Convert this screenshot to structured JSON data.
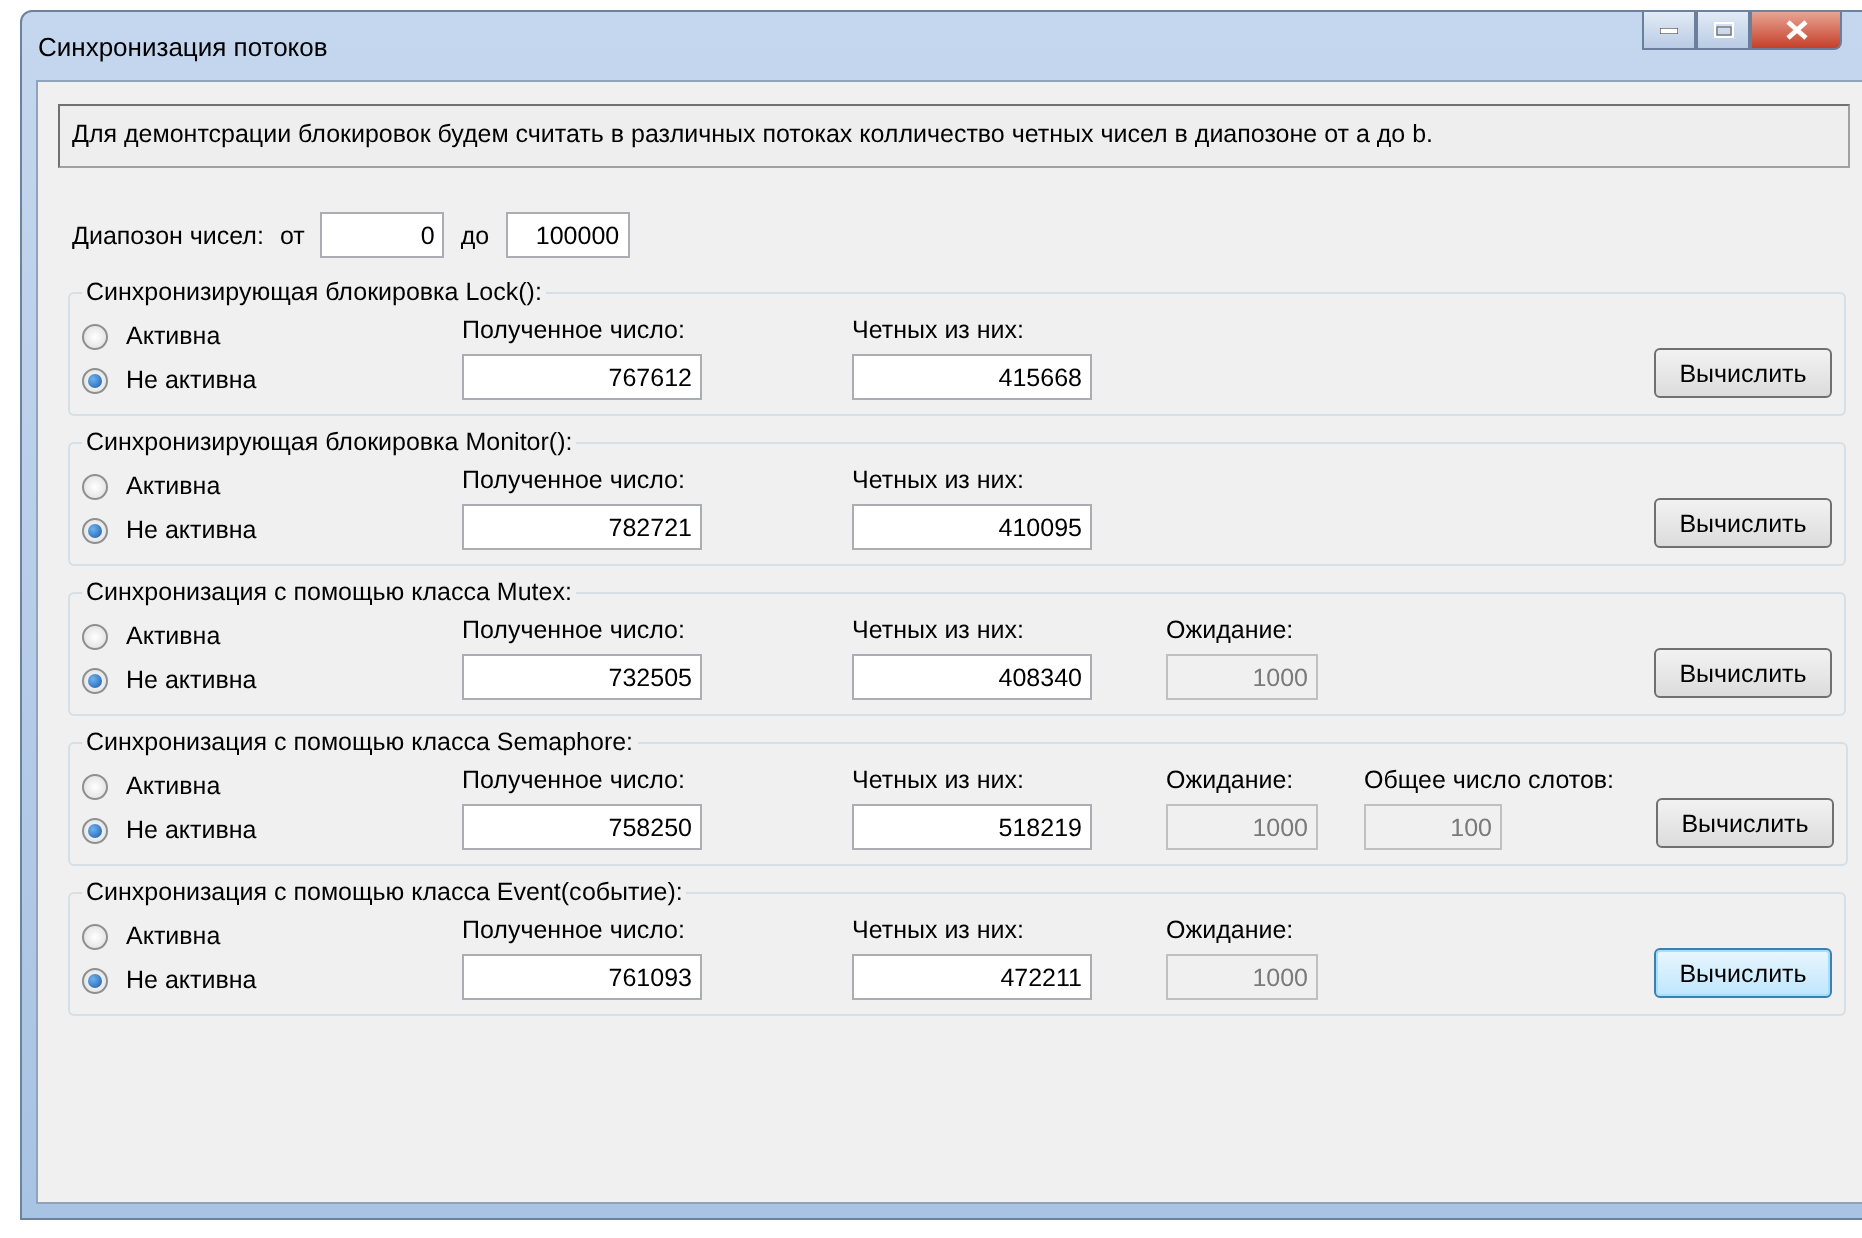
{
  "window": {
    "title": "Синхронизация потоков"
  },
  "description": "Для демонтсрации блокировок будем считать в различных потоках колличество четных чисел в диапозоне от a до b.",
  "range": {
    "label": "Диапозон чисел:",
    "from_label": "от",
    "from_value": "0",
    "to_label": "до",
    "to_value": "100000"
  },
  "groups": [
    {
      "title": "Синхронизирующая блокировка Lock():",
      "radios": [
        {
          "label": "Активна",
          "selected": false
        },
        {
          "label": "Не активна",
          "selected": true
        }
      ],
      "fields": [
        {
          "label": "Полученное число:",
          "value": "767612",
          "disabled": false
        },
        {
          "label": "Четных из них:",
          "value": "415668",
          "disabled": false
        }
      ],
      "button": {
        "label": "Вычислить",
        "focused": false
      }
    },
    {
      "title": "Синхронизирующая блокировка Monitor():",
      "radios": [
        {
          "label": "Активна",
          "selected": false
        },
        {
          "label": "Не активна",
          "selected": true
        }
      ],
      "fields": [
        {
          "label": "Полученное число:",
          "value": "782721",
          "disabled": false
        },
        {
          "label": "Четных из них:",
          "value": "410095",
          "disabled": false
        }
      ],
      "button": {
        "label": "Вычислить",
        "focused": false
      }
    },
    {
      "title": "Синхронизация с помощью класса Mutex:",
      "radios": [
        {
          "label": "Активна",
          "selected": false
        },
        {
          "label": "Не активна",
          "selected": true
        }
      ],
      "fields": [
        {
          "label": "Полученное число:",
          "value": "732505",
          "disabled": false
        },
        {
          "label": "Четных из них:",
          "value": "408340",
          "disabled": false
        },
        {
          "label": "Ожидание:",
          "value": "1000",
          "disabled": true
        }
      ],
      "button": {
        "label": "Вычислить",
        "focused": false
      }
    },
    {
      "title": "Синхронизация с помощью класса Semaphore:",
      "radios": [
        {
          "label": "Активна",
          "selected": false
        },
        {
          "label": "Не активна",
          "selected": true
        }
      ],
      "fields": [
        {
          "label": "Полученное число:",
          "value": "758250",
          "disabled": false
        },
        {
          "label": "Четных из них:",
          "value": "518219",
          "disabled": false
        },
        {
          "label": "Ожидание:",
          "value": "1000",
          "disabled": true
        },
        {
          "label": "Общее число слотов:",
          "value": "100",
          "disabled": true
        }
      ],
      "button": {
        "label": "Вычислить",
        "focused": false
      }
    },
    {
      "title": "Синхронизация с помощью класса Event(событие):",
      "radios": [
        {
          "label": "Активна",
          "selected": false
        },
        {
          "label": "Не активна",
          "selected": true
        }
      ],
      "fields": [
        {
          "label": "Полученное число:",
          "value": "761093",
          "disabled": false
        },
        {
          "label": "Четных из них:",
          "value": "472211",
          "disabled": false
        },
        {
          "label": "Ожидание:",
          "value": "1000",
          "disabled": true
        }
      ],
      "button": {
        "label": "Вычислить",
        "focused": true
      }
    }
  ]
}
